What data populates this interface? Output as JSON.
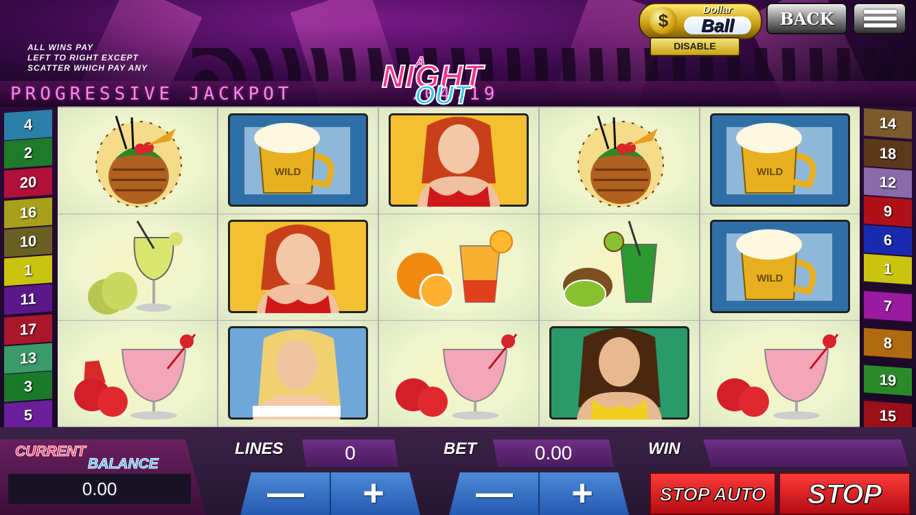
{
  "header": {
    "rules": [
      "ALL WINS PAY",
      "LEFT TO RIGHT EXCEPT",
      "SCATTER WHICH PAY ANY"
    ],
    "jackpot_label": "PROGRESSIVE JACKPOT",
    "jackpot_value": ".04.19",
    "logo": {
      "a": "A",
      "night": "NIGHT",
      "out": "OUT"
    },
    "dollar_ball": {
      "coin": "$",
      "line1": "Dollar",
      "line2": "Ball",
      "disable": "DISABLE"
    },
    "back": "BACK"
  },
  "paylines_left": [
    "4",
    "2",
    "20",
    "16",
    "10",
    "1",
    "11",
    "17",
    "13",
    "3",
    "5"
  ],
  "paylines_right": [
    "14",
    "18",
    "12",
    "9",
    "6",
    "1",
    "7",
    "8",
    "19",
    "15"
  ],
  "reels": [
    [
      "pineapple-cocktail",
      "pear-cocktail",
      "strawberry-cocktail"
    ],
    [
      "beer-wild",
      "redhead-girl",
      "blonde-girl"
    ],
    [
      "redhead-girl",
      "orange-cocktail",
      "strawberry-cocktail"
    ],
    [
      "pineapple-cocktail",
      "kiwi-cocktail",
      "brunette-girl"
    ],
    [
      "beer-wild",
      "beer-wild",
      "strawberry-cocktail"
    ]
  ],
  "wild_label": "WILD",
  "bottom": {
    "balance_label_1": "CURRENT",
    "balance_label_2": "BALANCE",
    "balance": "0.00",
    "lines_label": "LINES",
    "lines": "0",
    "bet_label": "BET",
    "bet": "0.00",
    "win_label": "WIN",
    "win": "",
    "minus": "—",
    "plus": "+",
    "stop_auto": "STOP AUTO",
    "stop": "STOP"
  },
  "colors": {
    "accent": "#ff2f8a",
    "cyan": "#31c6f0",
    "panel": "#3b2248",
    "button_red": "#d41c20",
    "stepper_blue": "#3a74c8"
  }
}
